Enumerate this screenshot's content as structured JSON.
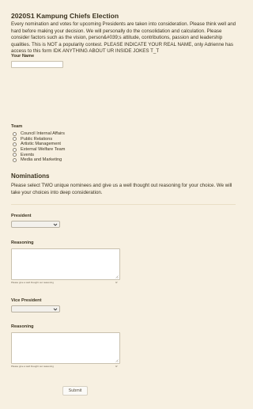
{
  "form": {
    "title": "2020S1 Kampung Chiefs Election",
    "intro": "Every nomination and votes for upcoming Presidents are taken into consideration. Please think well and hard before making your decision. We will personally do the consolidation and calculation. Please consider factors such as the vision, person&#039;s attitude, contributions, passion and leadership qualities. This is NOT a popularity contest. PLEASE INDICATE YOUR REAL NAME, only Adrienne has access to this form IDK ANYTHING ABOUT UR INSIDE JOKES T_T"
  },
  "name_field": {
    "label": "Your Name",
    "value": ""
  },
  "team": {
    "label": "Team",
    "options": [
      "Council Internal Affairs",
      "Public Relations",
      "Artistic Management",
      "External Welfare Team",
      "Events",
      "Media and Marketing"
    ]
  },
  "nominations": {
    "title": "Nominations",
    "description": "Please select TWO unique nominees and give us a well thought out reasoning for your choice. We will take your choices into deep consideration."
  },
  "president": {
    "label": "President",
    "selected": "",
    "reasoning_label": "Reasoning",
    "reasoning_value": "",
    "hint": "Please give a well thought out reasoning",
    "counter": "0/"
  },
  "vice_president": {
    "label": "Vice President",
    "selected": "",
    "reasoning_label": "Reasoning",
    "reasoning_value": "",
    "hint": "Please give a well thought out reasoning",
    "counter": "0/"
  },
  "submit_label": "Submit"
}
